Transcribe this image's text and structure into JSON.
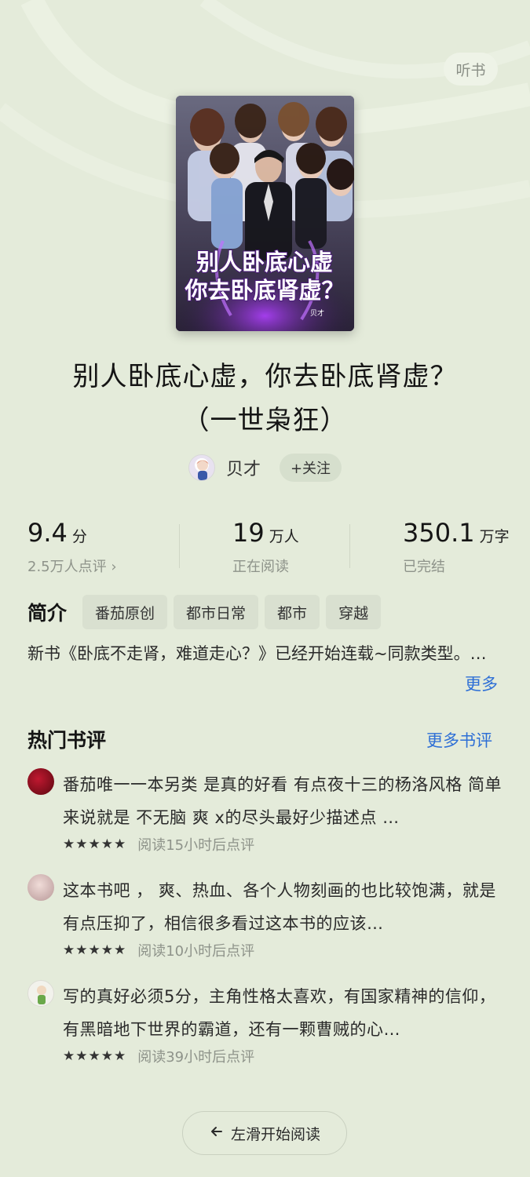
{
  "header": {
    "listen_label": "听书"
  },
  "book": {
    "cover_title_line1": "别人卧底心虚",
    "cover_title_line2": "你去卧底肾虚？",
    "cover_author_mark": "贝才",
    "title": "别人卧底心虚，你去卧底肾虚？（一世枭狂）"
  },
  "author": {
    "name": "贝才",
    "follow_label": "+关注"
  },
  "stats": {
    "rating": {
      "value": "9.4",
      "unit": "分",
      "sub": "2.5万人点评 ›"
    },
    "readers": {
      "value": "19",
      "unit": "万人",
      "sub": "正在阅读"
    },
    "words": {
      "value": "350.1",
      "unit": "万字",
      "sub": "已完结"
    }
  },
  "intro": {
    "title": "简介",
    "tags": [
      "番茄原创",
      "都市日常",
      "都市",
      "穿越"
    ],
    "text": "新书《卧底不走肾，难道走心？》已经开始连载~同款类型。…",
    "more_label": "更多"
  },
  "reviews_section": {
    "title": "热门书评",
    "more_label": "更多书评",
    "items": [
      {
        "text": "番茄唯一一本另类 是真的好看 有点夜十三的杨洛风格 简单来说就是 不无脑 爽 x的尽头最好少描述点 …",
        "stars": "★★★★★",
        "meta": "阅读15小时后点评",
        "avatar_color": "#8a1020"
      },
      {
        "text": "这本书吧 ， 爽、热血、各个人物刻画的也比较饱满，就是有点压抑了，相信很多看过这本书的应该…",
        "stars": "★★★★★",
        "meta": "阅读10小时后点评",
        "avatar_color": "#d8b8b8"
      },
      {
        "text": "写的真好必须5分，主角性格太喜欢，有国家精神的信仰，有黑暗地下世界的霸道，还有一颗曹贼的心…",
        "stars": "★★★★★",
        "meta": "阅读39小时后点评",
        "avatar_color": "#eef0e8"
      }
    ]
  },
  "footer": {
    "start_label": "左滑开始阅读"
  }
}
